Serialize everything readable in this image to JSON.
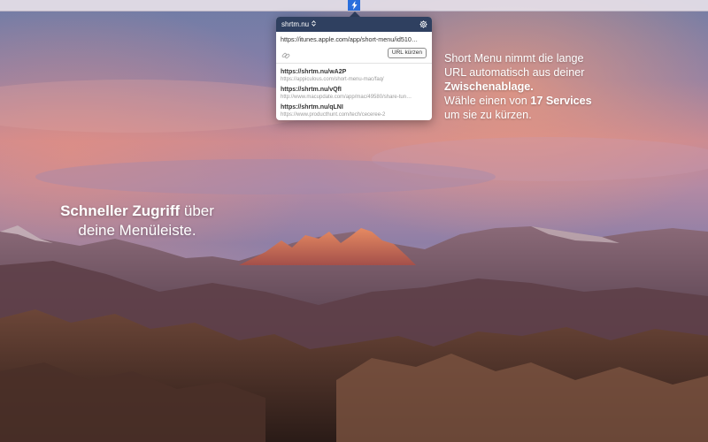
{
  "colors": {
    "menubar_icon_bg": "#2a6fdc",
    "popover_header_bg": "#2f4060",
    "text_white": "#ffffff"
  },
  "menubar": {
    "app_icon": "lightning-bolt-icon"
  },
  "popover": {
    "service_name": "shrtm.nu",
    "service_chevron": "up-down-chevron-icon",
    "settings_icon": "gear-icon",
    "url_value": "https://itunes.apple.com/app/short-menu/id510…",
    "link_icon": "link-chain-icon",
    "shorten_button_label": "URL kürzen",
    "history": [
      {
        "short": "https://shrtm.nu/wA2P",
        "long": "https://appiculous.com/short-menu-mac/faq/"
      },
      {
        "short": "https://shrtm.nu/vQfI",
        "long": "http://www.macupdate.com/app/mac/49580/share-tun…"
      },
      {
        "short": "https://shrtm.nu/qLNI",
        "long": "https://www.producthunt.com/tech/ceceree-2"
      }
    ]
  },
  "caption_right": {
    "line1": "Short Menu nimmt die lange",
    "line2": "URL automatisch aus deiner",
    "line3_bold": "Zwischenablage.",
    "line4_pre": "Wähle einen von ",
    "line4_bold": "17 Services",
    "line5": "um sie zu kürzen."
  },
  "caption_left": {
    "bold": "Schneller Zugriff",
    "rest1": " über",
    "line2": "deine Menüleiste."
  }
}
